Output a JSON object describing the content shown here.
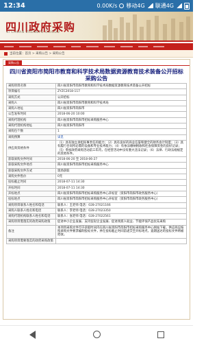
{
  "status_bar": {
    "time": "12:34",
    "speed": "0.00K/s",
    "network": "移动4G",
    "network2": "联通4G"
  },
  "site": {
    "title": "四川政府采购",
    "subtitle": "SI CHUAN ZHENGFU CAIGOU"
  },
  "breadcrumb": {
    "text": "当前位置：首页 > 采购公告 > 采购公告"
  },
  "tab_label": "采购公告",
  "document_title": "四川省资阳市简阳市教育和科学技术局数据资源教育技术装备公开招标采购公告",
  "rows": [
    {
      "key": "采购项目名称",
      "value": "四川省资阳市简阳市教育和科学技术局数据资源教育技术装备公开招标"
    },
    {
      "key": "项目编号",
      "value": "ZYZC2018-117"
    },
    {
      "key": "采购方式",
      "value": "公开招标"
    },
    {
      "key": "采购人",
      "value": "四川省资阳市简阳市教育和科学技术局"
    },
    {
      "key": "采购人地址",
      "value": "四川省资阳市简阳市"
    },
    {
      "key": "公告发布时间",
      "value": "2018-06-20 10:00"
    },
    {
      "key": "采购代理机构",
      "value": "四川省资阳市简阳市招标采购服务中心"
    },
    {
      "key": "采购代理机构地址",
      "value": "四川省资阳市简阳市"
    },
    {
      "key": "采购包个数",
      "value": "1"
    },
    {
      "key": "采购预算",
      "value": "详见"
    },
    {
      "key": "供应商资格条件",
      "value": "（1）具有独立承担民事责任的能力；（2）具有良好的商业信誉和健全的财务会计制度；（3）具有履行合同所必需的设备和专业技术能力；（4）有依法缴纳税收和社会保障资金的良好记录；（5）参加政府采购活动前三年内，在经营活动中没有重大违法记录；（6）法律、行政法规规定的其他条件。"
    },
    {
      "key": "获取采购文件时间",
      "value": "2018-06-20 至 2018-06-27"
    },
    {
      "key": "获取采购文件地点",
      "value": "四川省资阳市简阳市招标采购服务中心"
    },
    {
      "key": "获取采购文件方式",
      "value": "现场获取"
    },
    {
      "key": "采购文件售价",
      "value": "0元"
    },
    {
      "key": "投标截止时间",
      "value": "2018-07-11 14:30"
    },
    {
      "key": "开标时间",
      "value": "2018-07-11 14:30"
    },
    {
      "key": "开标地点",
      "value": "四川省资阳市简阳市招标采购服务中心开标室（资阳市简阳市政务服务中心）"
    },
    {
      "key": "投标地点",
      "value": "四川省资阳市简阳市招标采购服务中心开标室（资阳市简阳市政务服务中心）"
    },
    {
      "key": "采购项目联系人姓名和电话",
      "value": "联系人：王老师 电话：028-27021166"
    },
    {
      "key": "采购人联系人姓名和电话",
      "value": "联系人：李老师 电话：028-27023350"
    },
    {
      "key": "采购代理机构联系人姓名和电话",
      "value": "联系人：张老师 电话：028-27022561"
    },
    {
      "key": "采购项目需落实的政府采购政策",
      "value": "促进中小企业发展、支持监狱企业发展、促进残疾人就业、节能环保产品优先采购"
    },
    {
      "key": "备注",
      "value": "本项目采购文件可于获取时间内在四川省资阳市简阳市招标采购服务中心网站下载，供应商应按照采购文件要求编制投标文件，并在投标截止时间前递交至开标地点，逾期送达的投标文件将被拒收。"
    },
    {
      "key": "采购项目需要落实的政府采购政策",
      "value": ""
    }
  ],
  "colors": {
    "brand_red": "#c4201b",
    "status_bar": "#2a6fa8",
    "title_blue": "#1a237e"
  },
  "icons": [
    "home-icon",
    "back-icon",
    "home-circle-icon",
    "recent-apps-icon"
  ]
}
